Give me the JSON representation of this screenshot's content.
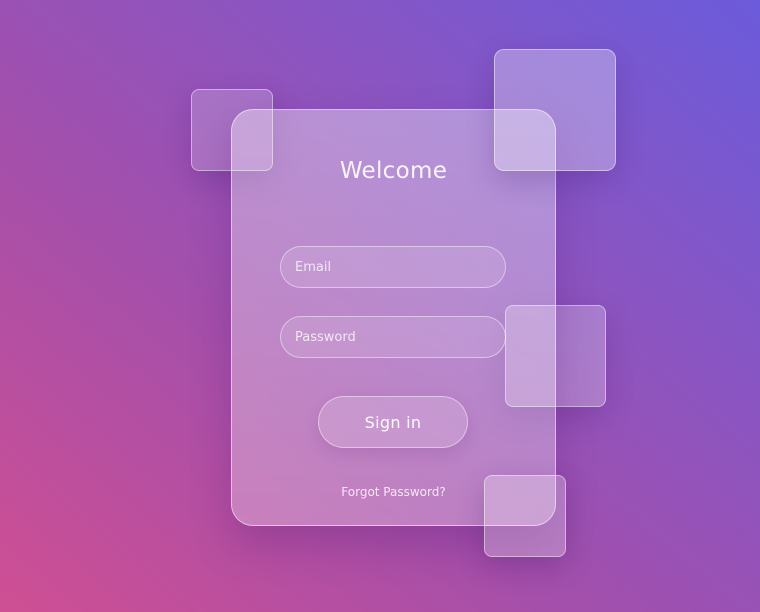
{
  "theme": {
    "background_gradient": [
      "#cf4f93",
      "#a44fab",
      "#8a55c2",
      "#6b5bdb"
    ],
    "text_color": "#ffffff"
  },
  "login": {
    "title": "Welcome",
    "email_placeholder": "Email",
    "email_value": "",
    "password_placeholder": "Password",
    "password_value": "",
    "sign_in_label": "Sign in",
    "forgot_password_label": "Forgot Password?"
  }
}
